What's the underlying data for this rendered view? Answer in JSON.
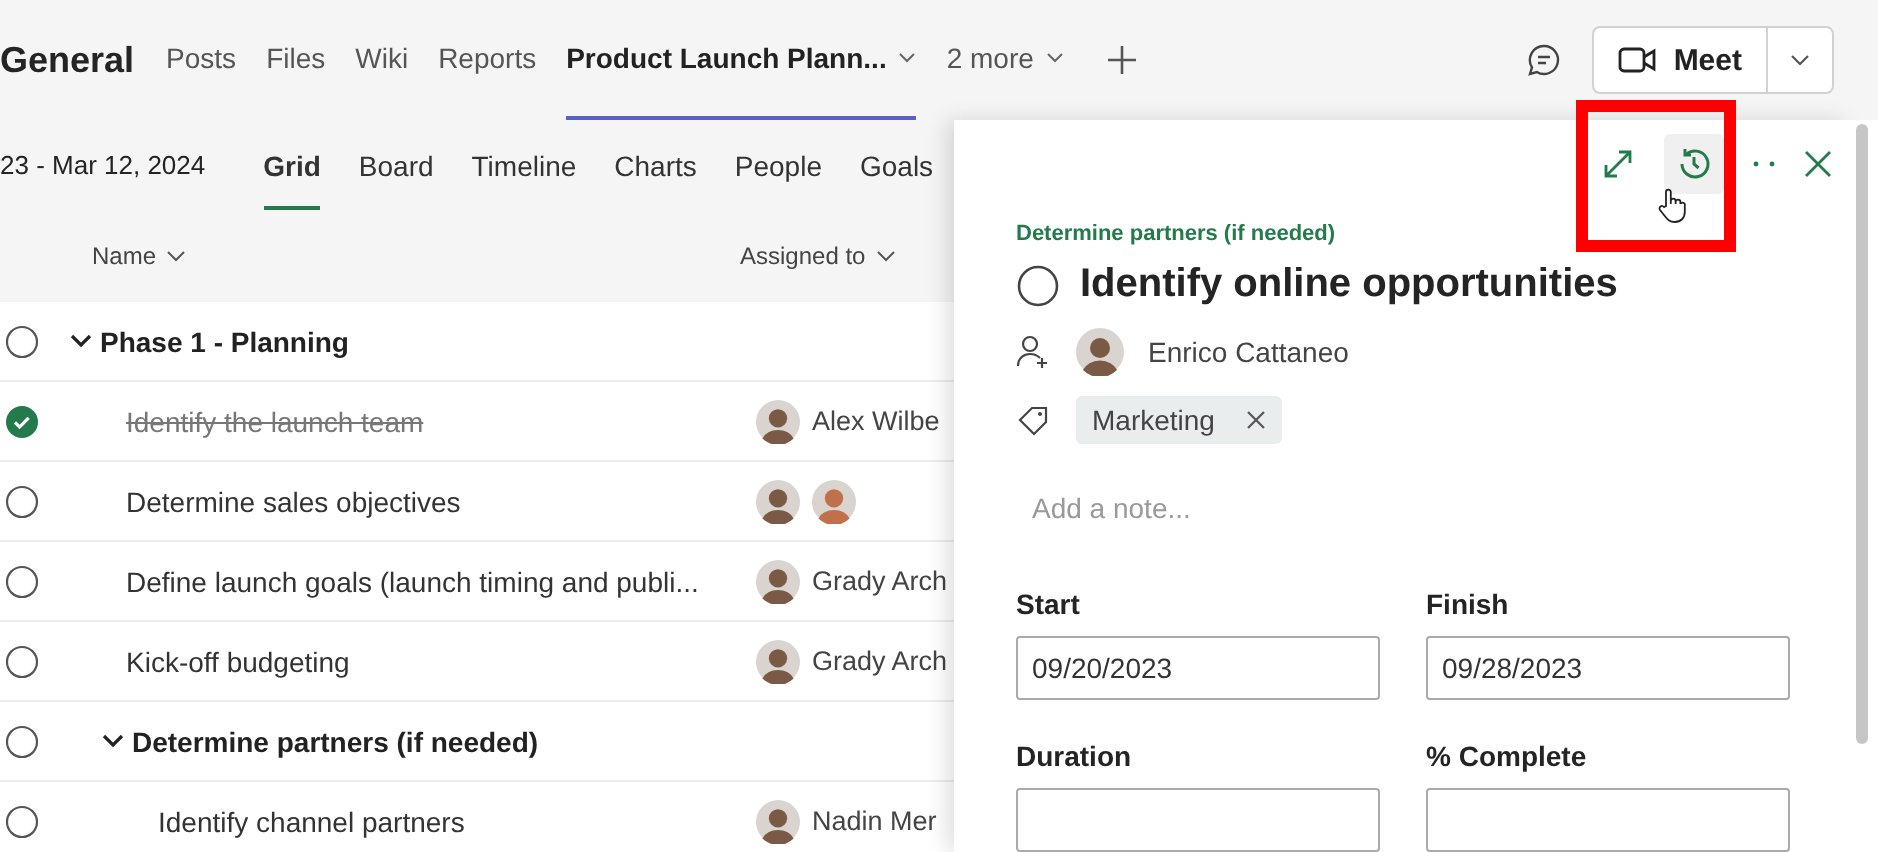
{
  "header": {
    "channel": "General",
    "tabs": [
      {
        "label": "Posts",
        "selected": false,
        "caret": false
      },
      {
        "label": "Files",
        "selected": false,
        "caret": false
      },
      {
        "label": "Wiki",
        "selected": false,
        "caret": false
      },
      {
        "label": "Reports",
        "selected": false,
        "caret": false
      },
      {
        "label": "Product Launch Plann...",
        "selected": true,
        "caret": true
      },
      {
        "label": "2 more",
        "selected": false,
        "caret": true
      }
    ],
    "meet_button": {
      "label": "Meet"
    }
  },
  "date_range": "23 - Mar 12, 2024",
  "views": [
    {
      "label": "Grid",
      "selected": true
    },
    {
      "label": "Board",
      "selected": false
    },
    {
      "label": "Timeline",
      "selected": false
    },
    {
      "label": "Charts",
      "selected": false
    },
    {
      "label": "People",
      "selected": false
    },
    {
      "label": "Goals",
      "selected": false
    }
  ],
  "columns": [
    "Name",
    "Assigned to"
  ],
  "rows": [
    {
      "kind": "group",
      "name": "Phase 1 - Planning",
      "completed": false,
      "expanded": true,
      "children": [
        {
          "kind": "task",
          "name": "Identify the launch team",
          "completed": true,
          "avatars": [
            {
              "kind": "man"
            }
          ],
          "assignee": "Alex Wilbe"
        },
        {
          "kind": "task",
          "name": "Determine sales objectives",
          "completed": false,
          "avatars": [
            {
              "kind": "man"
            },
            {
              "kind": "woman"
            }
          ]
        },
        {
          "kind": "task",
          "name": "Define launch goals (launch timing and publi...",
          "completed": false,
          "avatars": [
            {
              "kind": "man"
            }
          ],
          "assignee": "Grady Arch"
        },
        {
          "kind": "task",
          "name": "Kick-off budgeting",
          "completed": false,
          "avatars": [
            {
              "kind": "man"
            }
          ],
          "assignee": "Grady Arch"
        },
        {
          "kind": "group",
          "name": "Determine partners (if needed)",
          "completed": false,
          "expanded": true,
          "children": [
            {
              "kind": "task",
              "name": "Identify channel partners",
              "completed": false,
              "avatars": [
                {
                  "kind": "man"
                }
              ],
              "assignee": "Nadin Mer"
            }
          ]
        }
      ]
    }
  ],
  "details": {
    "bucket": "Determine partners (if needed)",
    "title": "Identify online opportunities",
    "completed": false,
    "assignee": "Enrico Cattaneo",
    "labels": [
      {
        "label": "Marketing"
      }
    ],
    "note": {
      "placeholder": "Add a note..."
    },
    "fields": [
      {
        "label": "Start",
        "value": "09/20/2023"
      },
      {
        "label": "Finish",
        "value": "09/28/2023"
      },
      {
        "label": "Duration"
      },
      {
        "label": "% Complete"
      }
    ]
  }
}
